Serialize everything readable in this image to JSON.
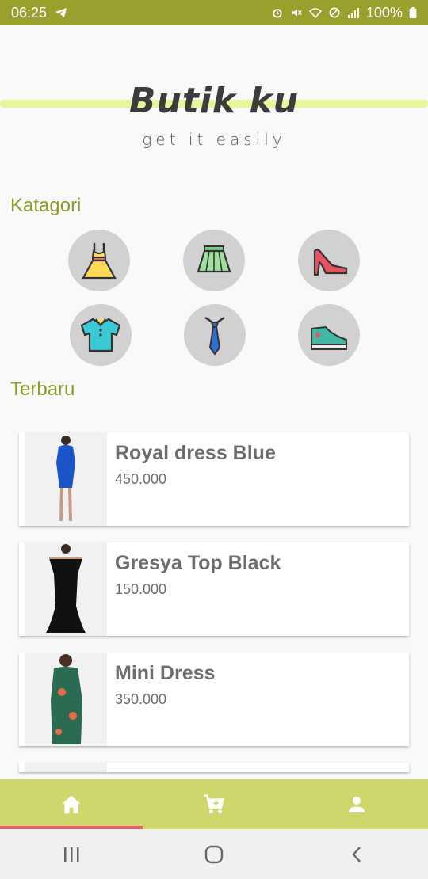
{
  "status_bar": {
    "time": "06:25",
    "battery": "100%"
  },
  "logo": {
    "brand": "Butik ku",
    "tagline": "get it easily"
  },
  "sections": {
    "categories_title": "Katagori",
    "latest_title": "Terbaru"
  },
  "categories": [
    {
      "icon": "dress-icon",
      "color": "#ffd95a"
    },
    {
      "icon": "skirt-icon",
      "color": "#9fe0a0"
    },
    {
      "icon": "high-heel-icon",
      "color": "#e8535f"
    },
    {
      "icon": "polo-shirt-icon",
      "color": "#3cc9d6"
    },
    {
      "icon": "tie-icon",
      "color": "#2f6fd1"
    },
    {
      "icon": "sneaker-icon",
      "color": "#3fb8a4"
    }
  ],
  "products": [
    {
      "name": "Royal dress Blue",
      "price": "450.000",
      "color": "#1c54c9"
    },
    {
      "name": "Gresya Top Black",
      "price": "150.000",
      "color": "#111111"
    },
    {
      "name": "Mini Dress",
      "price": "350.000",
      "color": "#2b6b52"
    }
  ],
  "bottom_nav": [
    {
      "icon": "home-icon"
    },
    {
      "icon": "cart-icon"
    },
    {
      "icon": "person-icon"
    }
  ],
  "accent": {
    "status_bar": "#9aa02d",
    "section_title": "#8e9a2a",
    "nav_bg": "#cfd66c",
    "active_indicator": "#e86070"
  }
}
